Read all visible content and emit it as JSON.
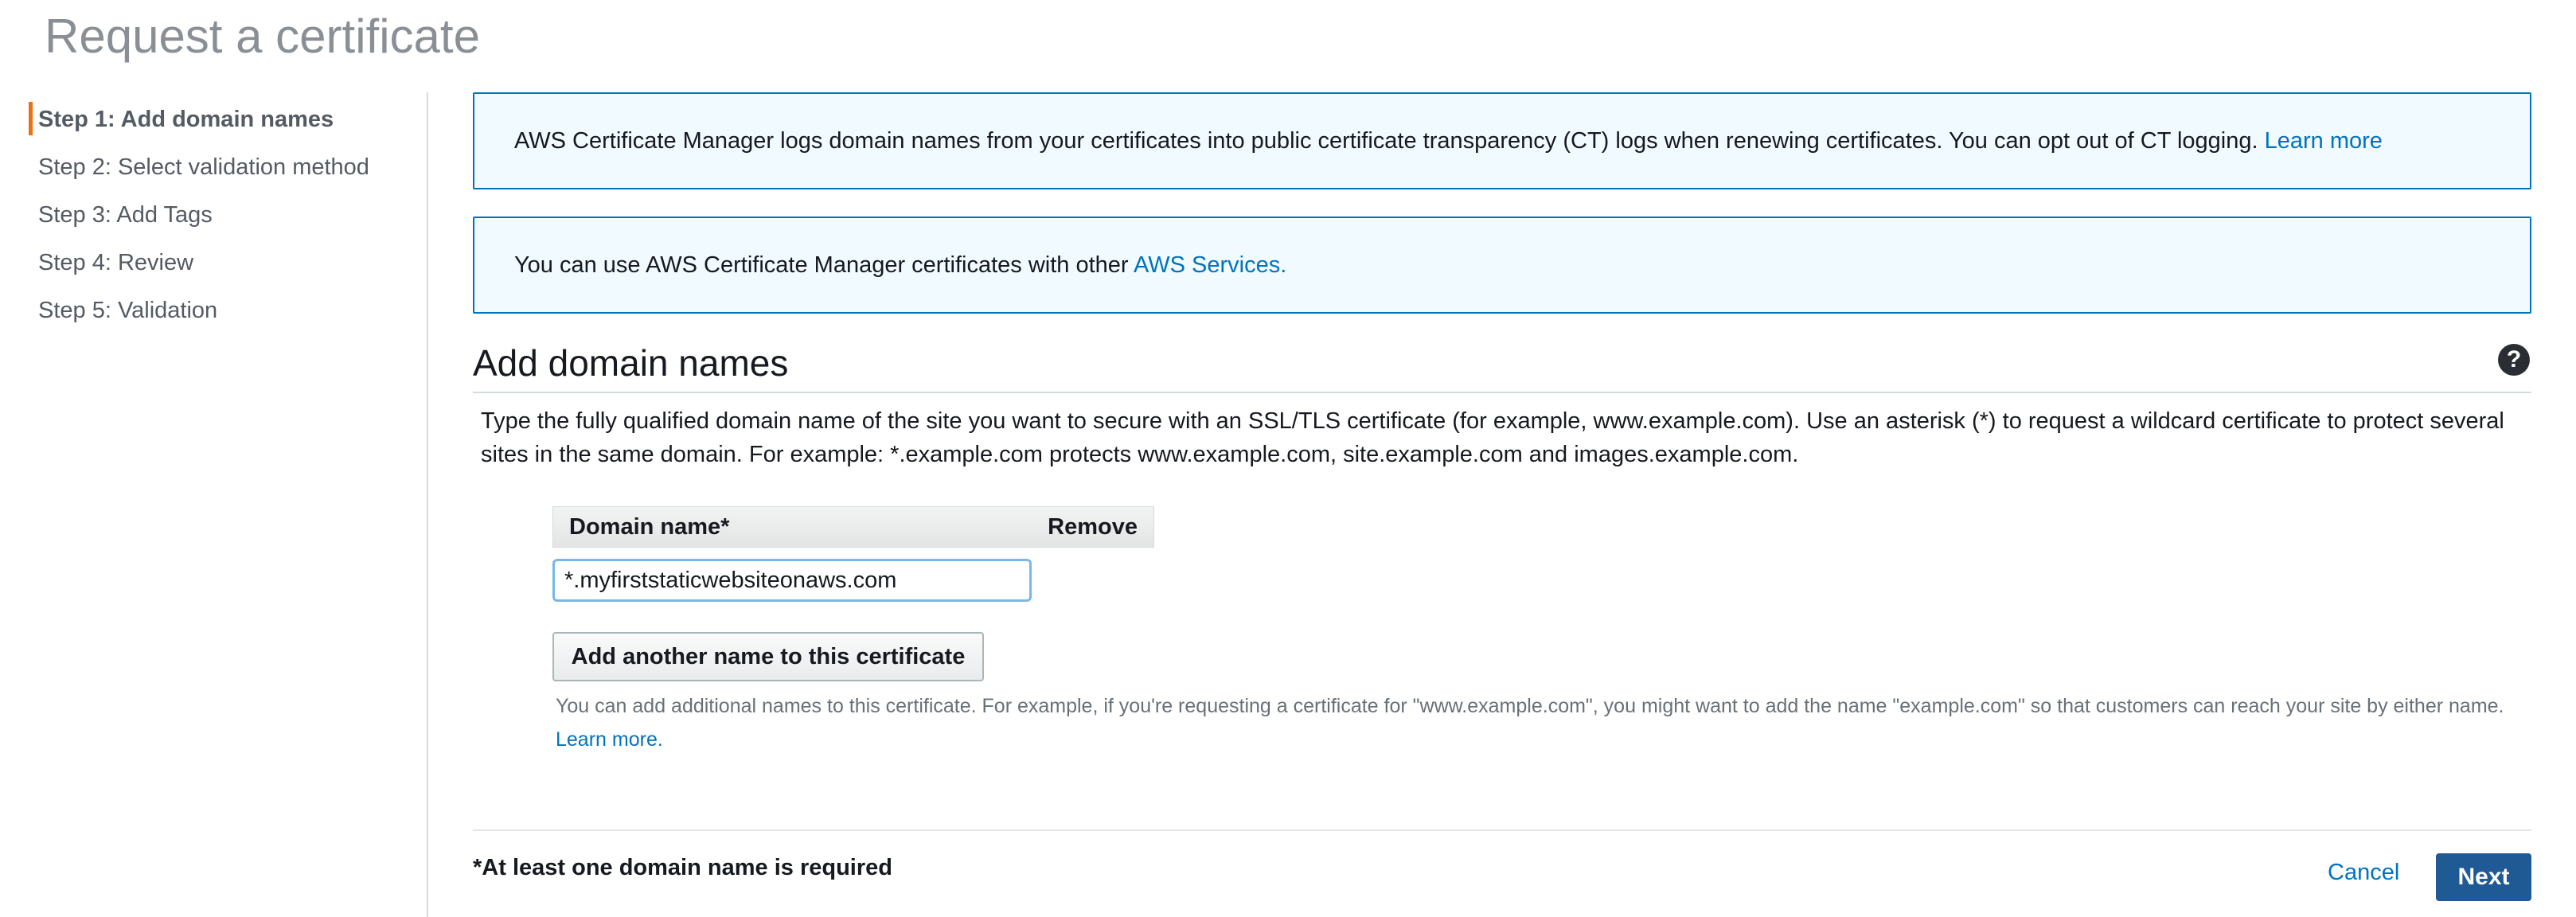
{
  "page": {
    "title": "Request a certificate"
  },
  "steps": [
    {
      "label": "Step 1: Add domain names",
      "active": true
    },
    {
      "label": "Step 2: Select validation method",
      "active": false
    },
    {
      "label": "Step 3: Add Tags",
      "active": false
    },
    {
      "label": "Step 4: Review",
      "active": false
    },
    {
      "label": "Step 5: Validation",
      "active": false
    }
  ],
  "info": {
    "ct_text": "AWS Certificate Manager logs domain names from your certificates into public certificate transparency (CT) logs when renewing certificates. You can opt out of CT logging. ",
    "ct_link": "Learn more",
    "services_text": "You can use AWS Certificate Manager certificates with other ",
    "services_link": "AWS Services."
  },
  "section": {
    "title": "Add domain names",
    "description": "Type the fully qualified domain name of the site you want to secure with an SSL/TLS certificate (for example, www.example.com). Use an asterisk (*) to request a wildcard certificate to protect several sites in the same domain. For example: *.example.com protects www.example.com, site.example.com and images.example.com."
  },
  "table": {
    "col_domain": "Domain name*",
    "col_remove": "Remove",
    "domain_value": "*.myfirststaticwebsiteonaws.com"
  },
  "add_button": "Add another name to this certificate",
  "hint": {
    "text": "You can add additional names to this certificate. For example, if you're requesting a certificate for \"www.example.com\", you might want to add the name \"example.com\" so that customers can reach your site by either name. ",
    "link": "Learn more."
  },
  "footer": {
    "required_note": "*At least one domain name is required",
    "cancel": "Cancel",
    "next": "Next"
  },
  "colors": {
    "accent": "#ec7211",
    "link": "#0073bb",
    "info_border": "#0073bb",
    "info_bg": "#f1faff",
    "primary_button": "#1f5a94"
  },
  "icons": {
    "help": "help-icon"
  }
}
